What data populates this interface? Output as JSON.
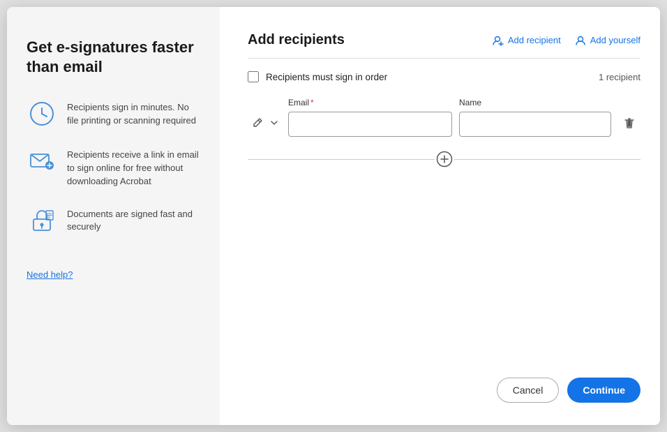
{
  "modal": {
    "left": {
      "title": "Get e-signatures faster than email",
      "features": [
        {
          "id": "clock",
          "text": "Recipients sign in minutes. No file printing or scanning required"
        },
        {
          "id": "envelope",
          "text": "Recipients receive a link in email to sign online for free without downloading Acrobat"
        },
        {
          "id": "lock",
          "text": "Documents are signed fast and securely"
        }
      ],
      "need_help_label": "Need help?"
    },
    "right": {
      "title": "Add recipients",
      "add_recipient_label": "Add recipient",
      "add_yourself_label": "Add yourself",
      "divider": true,
      "checkbox_label": "Recipients must sign in order",
      "recipient_count": "1 recipient",
      "email_label": "Email",
      "email_required": true,
      "email_placeholder": "",
      "name_label": "Name",
      "name_placeholder": "",
      "cancel_label": "Cancel",
      "continue_label": "Continue"
    }
  }
}
